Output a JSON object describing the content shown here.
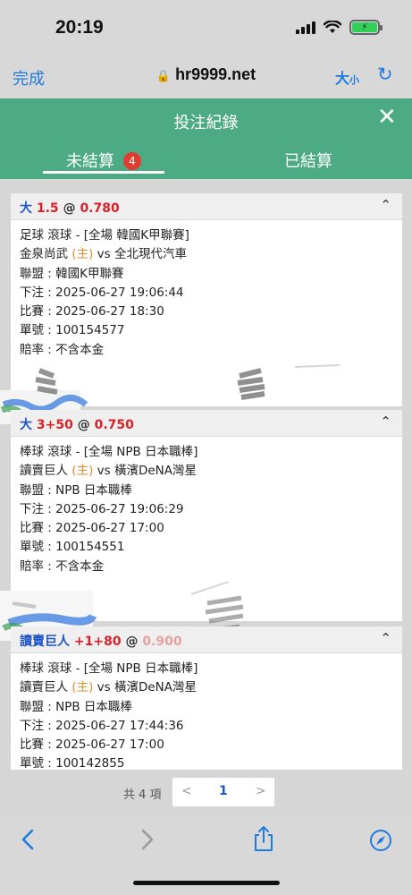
{
  "status_bar": {
    "time": "20:19"
  },
  "browser": {
    "done_label": "完成",
    "url": "hr9999.net",
    "text_size_big": "大",
    "text_size_small": "小"
  },
  "header": {
    "title": "投注紀錄"
  },
  "tabs": [
    {
      "label": "未結算",
      "badge": "4",
      "active": true
    },
    {
      "label": "已結算",
      "active": false
    }
  ],
  "bets": [
    {
      "head_team": "大",
      "head_line": "1.5",
      "head_at": "@",
      "head_odds": "0.780",
      "sport_line": "足球 滾球 - [全場 韓國K甲聯賽]",
      "home_team": "金泉尚武",
      "home_tag": "(主)",
      "vs": "vs",
      "away_team": "全北現代汽車",
      "league": "聯盟 : 韓國K甲聯賽",
      "bet_time": "下注 : 2025-06-27 19:06:44",
      "match_time": "比賽 : 2025-06-27 18:30",
      "order_no": "單號 : 100154577",
      "odds_type": "賠率 : 不含本金"
    },
    {
      "head_team": "大",
      "head_line": "3+50",
      "head_at": "@",
      "head_odds": "0.750",
      "sport_line": "棒球 滾球 - [全場 NPB 日本職棒]",
      "home_team": "讀賣巨人",
      "home_tag": "(主)",
      "vs": "vs",
      "away_team": "橫濱DeNA灣星",
      "league": "聯盟 : NPB 日本職棒",
      "bet_time": "下注 : 2025-06-27 19:06:29",
      "match_time": "比賽 : 2025-06-27 17:00",
      "order_no": "單號 : 100154551",
      "odds_type": "賠率 : 不含本金"
    },
    {
      "head_team": "讀賣巨人",
      "head_line": "+1+80",
      "head_at": "@",
      "head_odds": "0.900",
      "sport_line": "棒球 滾球 - [全場 NPB 日本職棒]",
      "home_team": "讀賣巨人",
      "home_tag": "(主)",
      "vs": "vs",
      "away_team": "橫濱DeNA灣星",
      "league": "聯盟 : NPB 日本職棒",
      "bet_time": "下注 : 2025-06-27 17:44:36",
      "match_time": "比賽 : 2025-06-27 17:00",
      "order_no": "單號 : 100142855"
    }
  ],
  "pagination": {
    "total": "共 4 項",
    "prev": "<",
    "current": "1",
    "next": ">"
  },
  "colors": {
    "header_green": "#4cab85",
    "accent_blue": "#1e7be0",
    "odds_red": "#d8222a",
    "badge_red": "#e03c31",
    "home_orange": "#e58b2a"
  },
  "icons": [
    "lock-icon",
    "reload-icon",
    "close-icon",
    "chevron-up-icon",
    "back-icon",
    "forward-icon",
    "share-icon",
    "compass-icon"
  ]
}
